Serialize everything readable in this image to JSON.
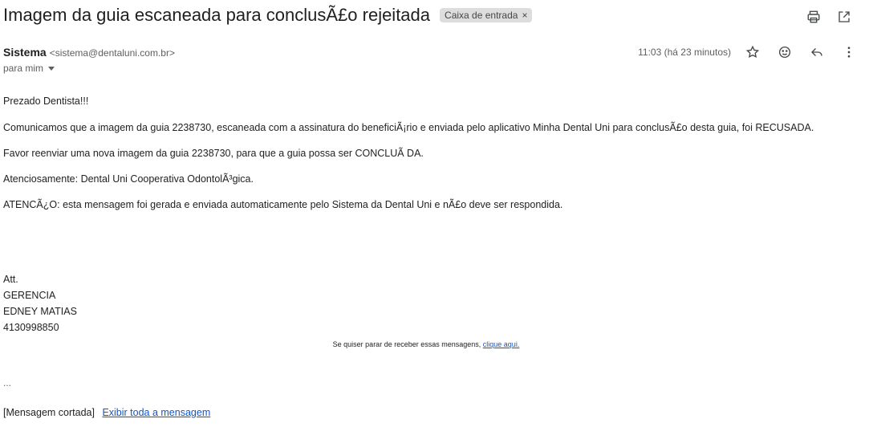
{
  "email": {
    "subject": "Imagem da guia escaneada para conclusÃ£o rejeitada",
    "label": "Caixa de entrada",
    "label_remove": "×",
    "sender_name": "Sistema",
    "sender_email": "<sistema@dentaluni.com.br>",
    "recipient": "para mim",
    "timestamp": "11:03 (há 23 minutos)",
    "body": {
      "greeting": "Prezado Dentista!!!",
      "p1": "Comunicamos que a imagem da guia 2238730, escaneada com a assinatura do beneficiÃ¡rio e enviada pelo aplicativo Minha Dental Uni para conclusÃ£o desta guia, foi RECUSADA.",
      "p2": "Favor reenviar uma nova imagem da guia 2238730, para que a guia possa ser CONCLUÃ DA.",
      "p3": "Atenciosamente: Dental Uni Cooperativa OdontolÃ³gica.",
      "p4": "ATENCÃ¿O: esta mensagem foi gerada e enviada automaticamente pelo Sistema da Dental Uni e nÃ£o deve ser respondida."
    },
    "signature": {
      "line1": "Att.",
      "line2": "GERENCIA",
      "line3": "EDNEY MATIAS",
      "line4": "4130998850"
    },
    "unsubscribe_text": "Se quiser parar de receber essas mensagens,",
    "unsubscribe_link": "clique aqui.",
    "ellipsis": "...",
    "clipped_text": "[Mensagem cortada]",
    "view_full_link": "Exibir toda a mensagem"
  },
  "icons": {
    "print": "print-icon",
    "new_window": "open-in-new-window-icon",
    "star": "star-icon",
    "emoji": "emoji-reaction-icon",
    "reply": "reply-icon",
    "more": "more-options-icon"
  }
}
